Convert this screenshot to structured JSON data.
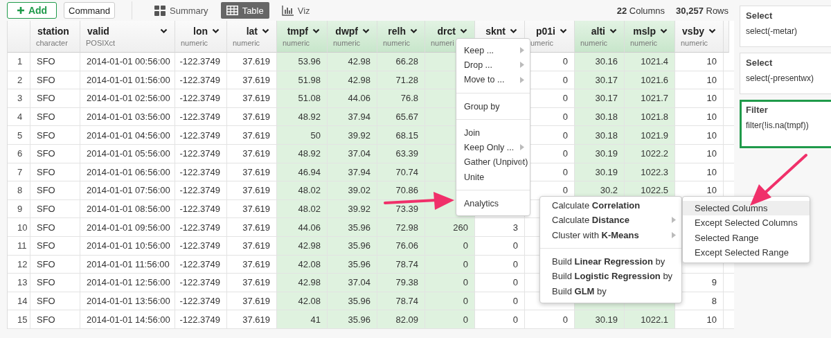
{
  "toolbar": {
    "add_button": "Add",
    "command_button": "Command",
    "view_tabs": [
      {
        "kind": "summary",
        "label": "Summary",
        "selected": false
      },
      {
        "kind": "table",
        "label": "Table",
        "selected": true
      },
      {
        "kind": "viz",
        "label": "Viz",
        "selected": false
      }
    ],
    "counts": {
      "columns": "**22** Columns",
      "rows": "**30,257** Rows"
    }
  },
  "table": {
    "columns": [
      {
        "name": "station",
        "type": "character",
        "selected": false
      },
      {
        "name": "valid",
        "type": "POSIXct",
        "selected": false
      },
      {
        "name": "lon",
        "type": "numeric",
        "selected": false
      },
      {
        "name": "lat",
        "type": "numeric",
        "selected": false
      },
      {
        "name": "tmpf",
        "type": "numeric",
        "selected": true
      },
      {
        "name": "dwpf",
        "type": "numeric",
        "selected": true
      },
      {
        "name": "relh",
        "type": "numeric",
        "selected": true
      },
      {
        "name": "drct",
        "type": "numeri",
        "selected": true
      },
      {
        "name": "sknt",
        "selected": false
      },
      {
        "name": "p01i",
        "type": "umeric",
        "selected": false
      },
      {
        "name": "alti",
        "type": "numeric",
        "selected": true
      },
      {
        "name": "mslp",
        "type": "numeric",
        "selected": true
      },
      {
        "name": "vsby",
        "type": "numeric",
        "selected": false
      }
    ],
    "rows": [
      {
        "num": "1",
        "cells": [
          "SFO",
          "2014-01-01 00:56:00",
          "-122.3749",
          "37.619",
          "53.96",
          "42.98",
          "66.28",
          null,
          null,
          "0",
          "30.16",
          "1021.4",
          "10"
        ]
      },
      {
        "num": "2",
        "cells": [
          "SFO",
          "2014-01-01 01:56:00",
          "-122.3749",
          "37.619",
          "51.98",
          "42.98",
          "71.28",
          null,
          null,
          "0",
          "30.17",
          "1021.6",
          "10"
        ]
      },
      {
        "num": "3",
        "cells": [
          "SFO",
          "2014-01-01 02:56:00",
          "-122.3749",
          "37.619",
          "51.08",
          "44.06",
          "76.8",
          null,
          null,
          "0",
          "30.17",
          "1021.7",
          "10"
        ]
      },
      {
        "num": "4",
        "cells": [
          "SFO",
          "2014-01-01 03:56:00",
          "-122.3749",
          "37.619",
          "48.92",
          "37.94",
          "65.67",
          null,
          null,
          "0",
          "30.18",
          "1021.8",
          "10"
        ]
      },
      {
        "num": "5",
        "cells": [
          "SFO",
          "2014-01-01 04:56:00",
          "-122.3749",
          "37.619",
          "50",
          "39.92",
          "68.15",
          null,
          null,
          "0",
          "30.18",
          "1021.9",
          "10"
        ]
      },
      {
        "num": "6",
        "cells": [
          "SFO",
          "2014-01-01 05:56:00",
          "-122.3749",
          "37.619",
          "48.92",
          "37.04",
          "63.39",
          null,
          null,
          "0",
          "30.19",
          "1022.2",
          "10"
        ]
      },
      {
        "num": "7",
        "cells": [
          "SFO",
          "2014-01-01 06:56:00",
          "-122.3749",
          "37.619",
          "46.94",
          "37.94",
          "70.74",
          null,
          null,
          "0",
          "30.19",
          "1022.3",
          "10"
        ]
      },
      {
        "num": "8",
        "cells": [
          "SFO",
          "2014-01-01 07:56:00",
          "-122.3749",
          "37.619",
          "48.02",
          "39.02",
          "70.86",
          null,
          null,
          "0",
          "30.2",
          "1022.5",
          "10"
        ]
      },
      {
        "num": "9",
        "cells": [
          "SFO",
          "2014-01-01 08:56:00",
          "-122.3749",
          "37.619",
          "48.02",
          "39.92",
          "73.39",
          null,
          null,
          null,
          null,
          null,
          null
        ]
      },
      {
        "num": "10",
        "cells": [
          "SFO",
          "2014-01-01 09:56:00",
          "-122.3749",
          "37.619",
          "44.06",
          "35.96",
          "72.98",
          "260",
          "3",
          null,
          null,
          null,
          null
        ]
      },
      {
        "num": "11",
        "cells": [
          "SFO",
          "2014-01-01 10:56:00",
          "-122.3749",
          "37.619",
          "42.98",
          "35.96",
          "76.06",
          "0",
          "0",
          null,
          null,
          null,
          null
        ]
      },
      {
        "num": "12",
        "cells": [
          "SFO",
          "2014-01-01 11:56:00",
          "-122.3749",
          "37.619",
          "42.08",
          "35.96",
          "78.74",
          "0",
          "0",
          null,
          null,
          null,
          null
        ]
      },
      {
        "num": "13",
        "cells": [
          "SFO",
          "2014-01-01 12:56:00",
          "-122.3749",
          "37.619",
          "42.98",
          "37.04",
          "79.38",
          "0",
          "0",
          null,
          null,
          null,
          "9"
        ]
      },
      {
        "num": "14",
        "cells": [
          "SFO",
          "2014-01-01 13:56:00",
          "-122.3749",
          "37.619",
          "42.08",
          "35.96",
          "78.74",
          "0",
          "0",
          null,
          null,
          null,
          "8"
        ]
      },
      {
        "num": "15",
        "cells": [
          "SFO",
          "2014-01-01 14:56:00",
          "-122.3749",
          "37.619",
          "41",
          "35.96",
          "82.09",
          "0",
          "0",
          "0",
          "30.19",
          "1022.1",
          "10"
        ]
      }
    ]
  },
  "context_menu": {
    "sections": [
      [
        {
          "label": "Keep ...",
          "submenu": true
        },
        {
          "label": "Drop ...",
          "submenu": true
        },
        {
          "label": "Move to ...",
          "submenu": true
        }
      ],
      [
        {
          "label": "Group by",
          "submenu": false
        }
      ],
      [
        {
          "label": "Join",
          "submenu": false
        },
        {
          "label": "Keep Only ...",
          "submenu": true
        },
        {
          "label": "Gather (Unpivot)",
          "submenu": true
        },
        {
          "label": "Unite",
          "submenu": false
        }
      ],
      [
        {
          "label": "Analytics",
          "submenu": false
        }
      ]
    ]
  },
  "analytics_menu": {
    "sections": [
      [
        {
          "label": "Calculate **Correlation**",
          "submenu": false
        },
        {
          "label": "Calculate **Distance**",
          "submenu": true
        },
        {
          "label": "Cluster with **K-Means**",
          "submenu": true
        }
      ],
      [
        {
          "label": "Build **Linear Regression** by",
          "submenu": false
        },
        {
          "label": "Build **Logistic Regression** by",
          "submenu": false
        },
        {
          "label": "Build **GLM** by",
          "submenu": false
        }
      ]
    ]
  },
  "correlation_menu": {
    "items": [
      {
        "label": "Selected Columns",
        "selected": true
      },
      {
        "label": "Except Selected Columns",
        "selected": false
      },
      {
        "label": "Selected Range",
        "selected": false
      },
      {
        "label": "Except Selected Range",
        "selected": false
      }
    ]
  },
  "steps": [
    {
      "title": "Select",
      "code": "select(-metar)",
      "selected": false
    },
    {
      "title": "Select",
      "code": "select(-presentwx)",
      "selected": false
    },
    {
      "title": "Filter",
      "code": "filter(!is.na(tmpf))",
      "selected": true
    }
  ]
}
